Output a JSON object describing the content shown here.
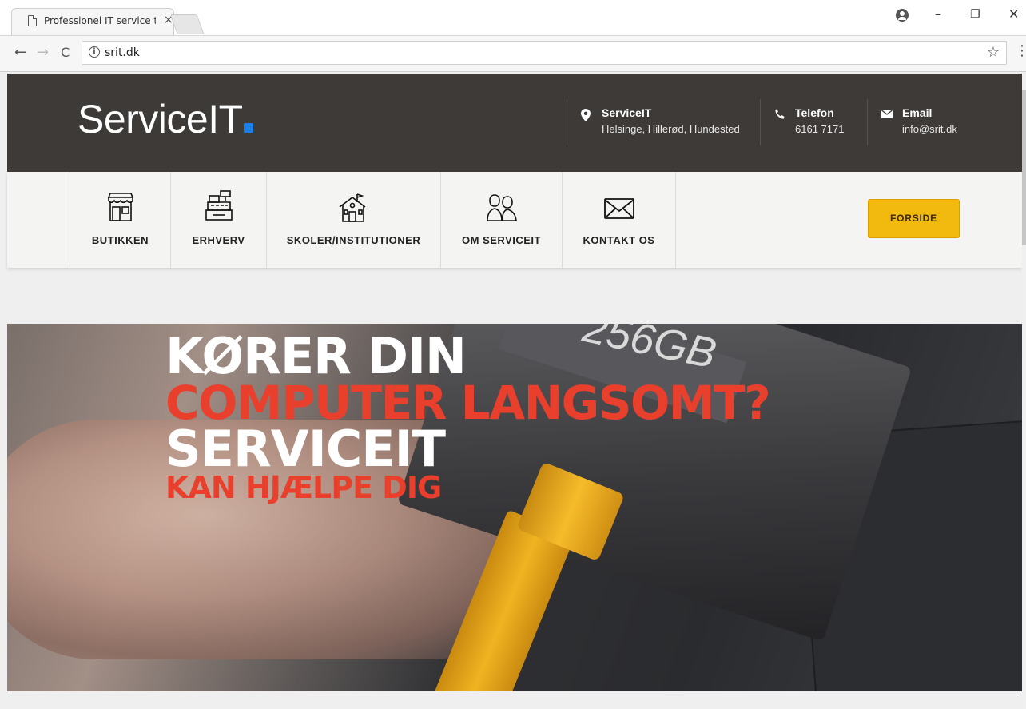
{
  "browser": {
    "tab_title": "Professionel IT service til",
    "tab_close": "×",
    "url": "srit.dk",
    "back": "←",
    "forward": "→",
    "reload": "C",
    "star": "☆",
    "menu": "⋮",
    "minimize": "–",
    "restore": "🗗",
    "close": "✕"
  },
  "header": {
    "logo_text": "ServiceIT",
    "contacts": [
      {
        "icon": "map-pin-icon",
        "glyph": "⚲",
        "title": "ServiceIT",
        "value": "Helsinge, Hillerød, Hundested"
      },
      {
        "icon": "phone-icon",
        "glyph": "✆",
        "title": "Telefon",
        "value": "6161 7171"
      },
      {
        "icon": "envelope-icon",
        "glyph": "✉",
        "title": "Email",
        "value": "info@srit.dk"
      }
    ]
  },
  "nav": {
    "items": [
      {
        "label": "BUTIKKEN",
        "icon": "shop-icon"
      },
      {
        "label": "ERHVERV",
        "icon": "cash-register-icon"
      },
      {
        "label": "SKOLER/INSTITUTIONER",
        "icon": "school-icon"
      },
      {
        "label": "OM SERVICEIT",
        "icon": "people-icon"
      },
      {
        "label": "KONTAKT OS",
        "icon": "mail-icon"
      }
    ],
    "cta": "FORSIDE"
  },
  "hero": {
    "line1": "KØRER DIN",
    "line2": "COMPUTER LANGSOMT?",
    "line3": "SERVICEIT",
    "line4": "KAN HJÆLPE DIG",
    "ssd_text": "256GB"
  },
  "colors": {
    "header_bg": "#3d3a38",
    "accent_blue": "#1a7fe0",
    "cta_yellow": "#f2b90f",
    "hero_red": "#e8402c"
  }
}
